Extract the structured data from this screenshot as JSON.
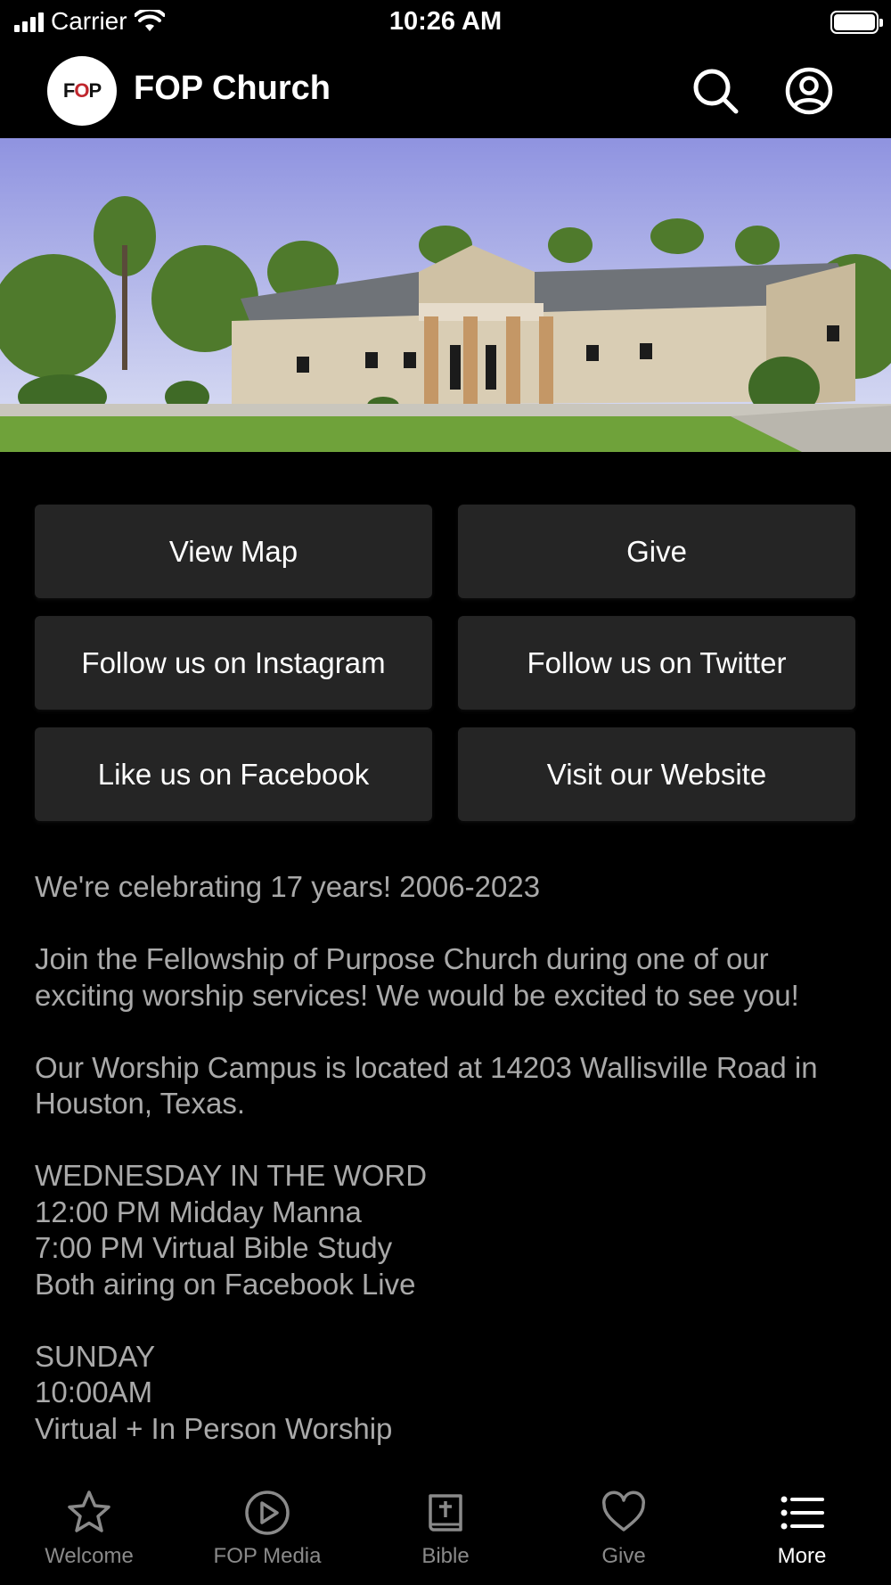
{
  "status_bar": {
    "carrier": "Carrier",
    "time": "10:26 AM"
  },
  "header": {
    "logo_text_left": "F",
    "logo_text_mid": "O",
    "logo_text_right": "P",
    "title": "FOP Church",
    "icons": [
      "search-icon",
      "account-icon"
    ]
  },
  "hero": {
    "image": "church-building-photo"
  },
  "buttons": {
    "view_map": "View Map",
    "give": "Give",
    "instagram": "Follow us on Instagram",
    "twitter": "Follow us on Twitter",
    "facebook": "Like us on Facebook",
    "website": "Visit our Website"
  },
  "info": {
    "p1": "We're celebrating 17 years! 2006-2023",
    "p2": "Join the Fellowship of Purpose Church during one of our exciting worship services! We would be excited to see you!",
    "p3": "Our Worship Campus is located at 14203 Wallisville Road in Houston, Texas.",
    "p4": "WEDNESDAY IN THE WORD\n12:00 PM Midday Manna\n7:00 PM  Virtual Bible Study\nBoth airing on Facebook Live",
    "p5": "SUNDAY\n10:00AM\nVirtual + In Person Worship"
  },
  "tabs": [
    {
      "label": "Welcome",
      "icon": "star-icon"
    },
    {
      "label": "FOP Media",
      "icon": "play-icon"
    },
    {
      "label": "Bible",
      "icon": "bible-icon"
    },
    {
      "label": "Give",
      "icon": "heart-icon"
    },
    {
      "label": "More",
      "icon": "list-icon",
      "active": true
    }
  ],
  "colors": {
    "background": "#000000",
    "button": "#252525",
    "body_text": "#a9a9a9",
    "tab_inactive": "#8a8a8a",
    "tab_active": "#ffffff"
  }
}
